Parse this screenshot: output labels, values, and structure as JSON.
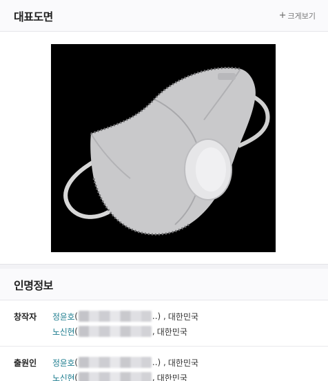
{
  "representative": {
    "title": "대표도면",
    "enlarge_label": "크게보기"
  },
  "person_info": {
    "title": "인명정보",
    "creators": {
      "label": "창작자",
      "people": [
        {
          "name": "정윤호",
          "open": "(",
          "close": "..) ,",
          "country": "대한민국"
        },
        {
          "name": "노신현",
          "open": "(",
          "close": ",",
          "country": "대한민국"
        }
      ]
    },
    "applicants": {
      "label": "출원인",
      "people": [
        {
          "name": "정윤호",
          "open": "(",
          "close": "..) ,",
          "country": "대한민국"
        },
        {
          "name": "노신현",
          "open": "(",
          "close": ",",
          "country": "대한민국"
        }
      ]
    }
  },
  "colors": {
    "name_link": "#1e7d8f",
    "figure_bg": "#000000"
  }
}
